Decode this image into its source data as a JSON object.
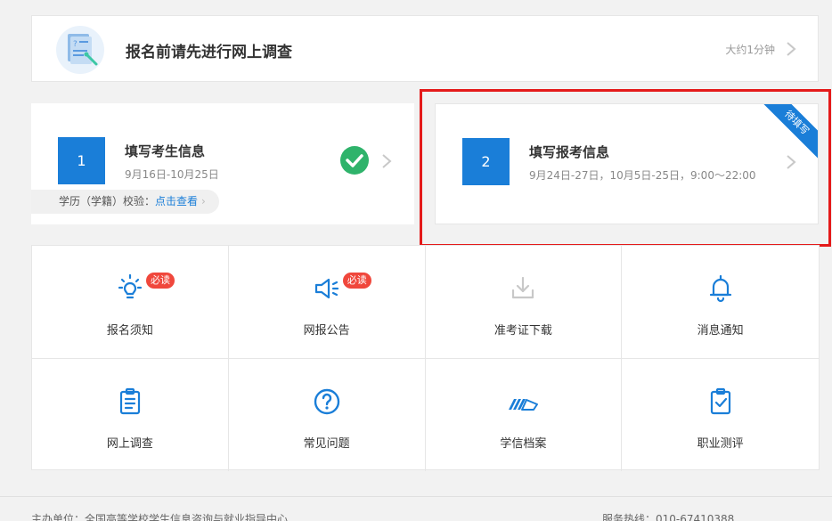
{
  "survey": {
    "title": "报名前请先进行网上调查",
    "duration": "大约1分钟"
  },
  "step1": {
    "number": "1",
    "title": "填写考生信息",
    "date": "9月16日-10月25日",
    "verify_label": "学历（学籍）校验：",
    "verify_link": "点击查看",
    "verify_chevron": "›"
  },
  "step2": {
    "number": "2",
    "title": "填写报考信息",
    "date": "9月24日-27日，10月5日-25日，9:00～22:00",
    "ribbon": "待填写"
  },
  "grid": {
    "items": [
      {
        "label": "报名须知",
        "icon": "bulb-icon",
        "badge": "必读"
      },
      {
        "label": "网报公告",
        "icon": "speaker-icon",
        "badge": "必读"
      },
      {
        "label": "准考证下载",
        "icon": "download-icon"
      },
      {
        "label": "消息通知",
        "icon": "bell-icon"
      },
      {
        "label": "网上调查",
        "icon": "clipboard-icon"
      },
      {
        "label": "常见问题",
        "icon": "question-icon"
      },
      {
        "label": "学信档案",
        "icon": "archive-logo-icon"
      },
      {
        "label": "职业测评",
        "icon": "checklist-icon"
      }
    ]
  },
  "footer": {
    "left": "主办单位：全国高等学校学生信息咨询与就业指导中心",
    "right": "服务热线：010-67410388"
  },
  "colors": {
    "accent": "#1a7ed8",
    "badge": "#f0473c",
    "check": "#2fb36b",
    "highlight": "#e41a1a"
  }
}
